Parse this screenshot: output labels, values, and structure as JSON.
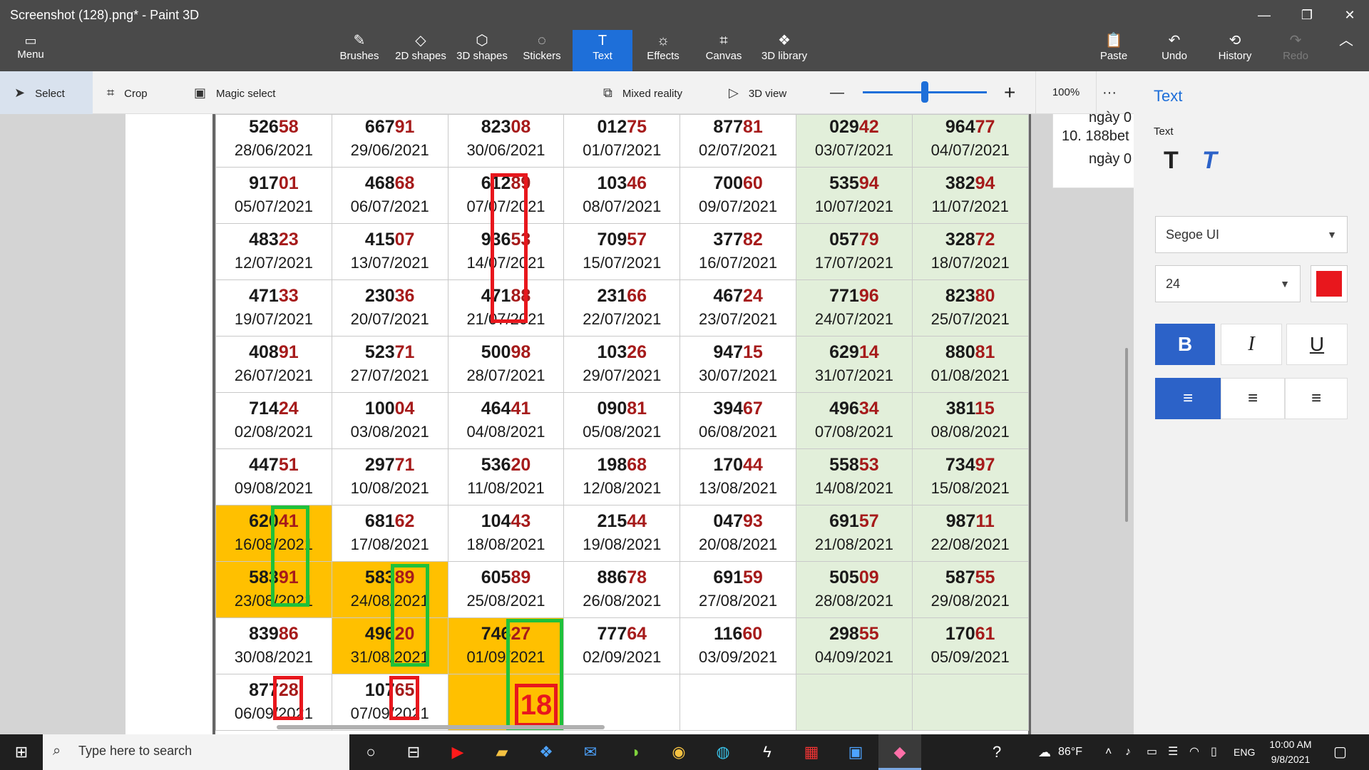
{
  "window": {
    "title": "Screenshot (128).png* - Paint 3D",
    "minimize_glyph": "—",
    "maximize_glyph": "❐",
    "close_glyph": "✕"
  },
  "ribbon": {
    "menu_label": "Menu",
    "tools": [
      {
        "label": "Brushes",
        "icon": "brush-icon",
        "glyph": "✎"
      },
      {
        "label": "2D shapes",
        "icon": "shapes-2d-icon",
        "glyph": "◇"
      },
      {
        "label": "3D shapes",
        "icon": "cube-icon",
        "glyph": "⬡"
      },
      {
        "label": "Stickers",
        "icon": "sticker-icon",
        "glyph": "◌"
      },
      {
        "label": "Text",
        "icon": "text-icon",
        "glyph": "T"
      },
      {
        "label": "Effects",
        "icon": "sun-icon",
        "glyph": "☼"
      },
      {
        "label": "Canvas",
        "icon": "canvas-icon",
        "glyph": "⌗"
      },
      {
        "label": "3D library",
        "icon": "library-icon",
        "glyph": "❖"
      }
    ],
    "active_tool": "Text",
    "right": [
      {
        "label": "Paste",
        "icon": "paste-icon",
        "glyph": "📋"
      },
      {
        "label": "Undo",
        "icon": "undo-icon",
        "glyph": "↶"
      },
      {
        "label": "History",
        "icon": "history-icon",
        "glyph": "⟲"
      },
      {
        "label": "Redo",
        "icon": "redo-icon",
        "glyph": "↷"
      }
    ],
    "collapse_glyph": "︿"
  },
  "toolbar2": {
    "select": "Select",
    "crop": "Crop",
    "magic_select": "Magic select",
    "mixed_reality": "Mixed reality",
    "view_3d": "3D view",
    "zoom_minus": "—",
    "zoom_plus": "+",
    "zoom": "100%",
    "more": "···",
    "zoom_level": 0.5
  },
  "panel": {
    "title": "Text",
    "sub": "Text",
    "font": "Segoe UI",
    "size": "24",
    "color": "#e8171d",
    "bold": "B",
    "italic": "I",
    "underline": "U",
    "align_left": "≡",
    "align_center": "≡",
    "align_right": "≡"
  },
  "side_text": {
    "line1": "ngày 0",
    "line2": "10. 188bet",
    "line3": "ngày 0"
  },
  "table": {
    "rows": [
      [
        [
          "526",
          "58",
          "28/06/2021"
        ],
        [
          "667",
          "91",
          "29/06/2021"
        ],
        [
          "823",
          "08",
          "30/06/2021"
        ],
        [
          "012",
          "75",
          "01/07/2021"
        ],
        [
          "877",
          "81",
          "02/07/2021"
        ],
        [
          "029",
          "42",
          "03/07/2021"
        ],
        [
          "964",
          "77",
          "04/07/2021"
        ]
      ],
      [
        [
          "917",
          "01",
          "05/07/2021"
        ],
        [
          "468",
          "68",
          "06/07/2021"
        ],
        [
          "612",
          "89",
          "07/07/2021"
        ],
        [
          "103",
          "46",
          "08/07/2021"
        ],
        [
          "700",
          "60",
          "09/07/2021"
        ],
        [
          "535",
          "94",
          "10/07/2021"
        ],
        [
          "382",
          "94",
          "11/07/2021"
        ]
      ],
      [
        [
          "483",
          "23",
          "12/07/2021"
        ],
        [
          "415",
          "07",
          "13/07/2021"
        ],
        [
          "936",
          "53",
          "14/07/2021"
        ],
        [
          "709",
          "57",
          "15/07/2021"
        ],
        [
          "377",
          "82",
          "16/07/2021"
        ],
        [
          "057",
          "79",
          "17/07/2021"
        ],
        [
          "328",
          "72",
          "18/07/2021"
        ]
      ],
      [
        [
          "471",
          "33",
          "19/07/2021"
        ],
        [
          "230",
          "36",
          "20/07/2021"
        ],
        [
          "471",
          "88",
          "21/07/2021"
        ],
        [
          "231",
          "66",
          "22/07/2021"
        ],
        [
          "467",
          "24",
          "23/07/2021"
        ],
        [
          "771",
          "96",
          "24/07/2021"
        ],
        [
          "823",
          "80",
          "25/07/2021"
        ]
      ],
      [
        [
          "408",
          "91",
          "26/07/2021"
        ],
        [
          "523",
          "71",
          "27/07/2021"
        ],
        [
          "500",
          "98",
          "28/07/2021"
        ],
        [
          "103",
          "26",
          "29/07/2021"
        ],
        [
          "947",
          "15",
          "30/07/2021"
        ],
        [
          "629",
          "14",
          "31/07/2021"
        ],
        [
          "880",
          "81",
          "01/08/2021"
        ]
      ],
      [
        [
          "714",
          "24",
          "02/08/2021"
        ],
        [
          "100",
          "04",
          "03/08/2021"
        ],
        [
          "464",
          "41",
          "04/08/2021"
        ],
        [
          "090",
          "81",
          "05/08/2021"
        ],
        [
          "394",
          "67",
          "06/08/2021"
        ],
        [
          "496",
          "34",
          "07/08/2021"
        ],
        [
          "381",
          "15",
          "08/08/2021"
        ]
      ],
      [
        [
          "447",
          "51",
          "09/08/2021"
        ],
        [
          "297",
          "71",
          "10/08/2021"
        ],
        [
          "536",
          "20",
          "11/08/2021"
        ],
        [
          "198",
          "68",
          "12/08/2021"
        ],
        [
          "170",
          "44",
          "13/08/2021"
        ],
        [
          "558",
          "53",
          "14/08/2021"
        ],
        [
          "734",
          "97",
          "15/08/2021"
        ]
      ],
      [
        [
          "620",
          "41",
          "16/08/2021"
        ],
        [
          "681",
          "62",
          "17/08/2021"
        ],
        [
          "104",
          "43",
          "18/08/2021"
        ],
        [
          "215",
          "44",
          "19/08/2021"
        ],
        [
          "047",
          "93",
          "20/08/2021"
        ],
        [
          "691",
          "57",
          "21/08/2021"
        ],
        [
          "987",
          "11",
          "22/08/2021"
        ]
      ],
      [
        [
          "583",
          "91",
          "23/08/2021"
        ],
        [
          "583",
          "89",
          "24/08/2021"
        ],
        [
          "605",
          "89",
          "25/08/2021"
        ],
        [
          "886",
          "78",
          "26/08/2021"
        ],
        [
          "691",
          "59",
          "27/08/2021"
        ],
        [
          "505",
          "09",
          "28/08/2021"
        ],
        [
          "587",
          "55",
          "29/08/2021"
        ]
      ],
      [
        [
          "839",
          "86",
          "30/08/2021"
        ],
        [
          "496",
          "20",
          "31/08/2021"
        ],
        [
          "746",
          "27",
          "01/09/2021"
        ],
        [
          "777",
          "64",
          "02/09/2021"
        ],
        [
          "116",
          "60",
          "03/09/2021"
        ],
        [
          "298",
          "55",
          "04/09/2021"
        ],
        [
          "170",
          "61",
          "05/09/2021"
        ]
      ],
      [
        [
          "877",
          "28",
          "06/09/2021"
        ],
        [
          "107",
          "65",
          "07/09/2021"
        ],
        [
          "",
          "",
          ""
        ],
        [
          "",
          "",
          ""
        ],
        [
          "",
          "",
          ""
        ],
        [
          "",
          "",
          ""
        ],
        [
          "",
          "",
          ""
        ]
      ]
    ],
    "highlighted": [
      "7-0",
      "8-0",
      "8-1",
      "9-1",
      "9-2",
      "10-2"
    ],
    "annotation_number": "18"
  },
  "taskbar": {
    "search_placeholder": "Type here to search",
    "weather": "86°F",
    "lang": "ENG",
    "time": "10:00 AM",
    "date": "9/8/2021"
  }
}
